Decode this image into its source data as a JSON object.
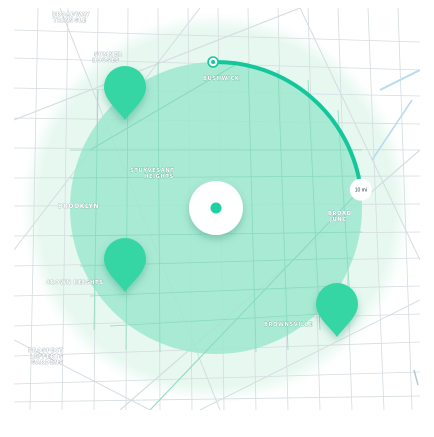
{
  "map": {
    "neighborhoods": [
      {
        "id": "broadway-triangle",
        "lines": [
          "BROADWAY",
          "TRIANGLE"
        ]
      },
      {
        "id": "sumner-houses",
        "lines": [
          "SUMNER",
          "HOUSES"
        ]
      },
      {
        "id": "bushwick",
        "lines": [
          "BUSHWICK"
        ]
      },
      {
        "id": "stuyvesant-heights",
        "lines": [
          "STUYVESANT",
          "HEIGHTS"
        ]
      },
      {
        "id": "brooklyn",
        "lines": [
          "BROOKLYN"
        ]
      },
      {
        "id": "crown-heights",
        "lines": [
          "CROWN HEIGHTS"
        ]
      },
      {
        "id": "prospect-lefferts-gardens",
        "lines": [
          "PROSPECT",
          "LEFFERTS",
          "GARDENS"
        ]
      },
      {
        "id": "brownsville",
        "lines": [
          "BROWNSVILLE"
        ]
      },
      {
        "id": "broadway-junction",
        "lines": [
          "BROAD",
          "JUNC"
        ]
      }
    ],
    "radius": {
      "label": "10 mi",
      "fraction": 0.23
    },
    "markers": [
      {
        "id": "marker-1"
      },
      {
        "id": "marker-2"
      },
      {
        "id": "marker-3"
      }
    ],
    "colors": {
      "accent": "#13c79a",
      "marker": "#36d7a4",
      "radius_fill": "#9de8d0",
      "outer_glow": "#e4f7ef",
      "street": "#d8dde0",
      "center_dot": "#1fcf9e"
    }
  }
}
